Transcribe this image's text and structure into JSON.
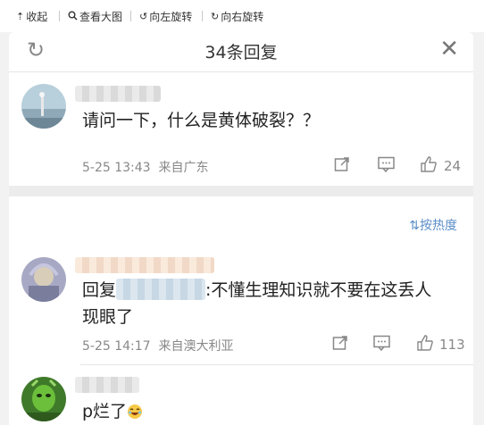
{
  "toolbar": {
    "collapse_icon": "upload-arrow-icon",
    "collapse": "收起",
    "view_large_icon": "magnifier-icon",
    "view_large": "查看大图",
    "rotate_left_icon": "rotate-left-icon",
    "rotate_left": "向左旋转",
    "rotate_right_icon": "rotate-right-icon",
    "rotate_right": "向右旋转"
  },
  "header": {
    "refresh_icon": "refresh-icon",
    "title": "34条回复",
    "close_icon": "close-icon"
  },
  "original": {
    "text": "请问一下，什么是黄体破裂？？",
    "time": "5-25 13:43",
    "location": "来自广东",
    "likes": "24"
  },
  "sort": {
    "icon": "sort-icon",
    "label": "按热度"
  },
  "replies": [
    {
      "prefix": "回复",
      "body": ":不懂生理知识就不要在这丢人现眼了",
      "time": "5-25 14:17",
      "location": "来自澳大利亚",
      "likes": "113"
    },
    {
      "body": "p烂了",
      "emoji": "laughing-emoji-icon"
    }
  ],
  "colors": {
    "background": "#f2f2f2",
    "panel": "#ffffff",
    "sort_link": "#5b8ec7",
    "meta_text": "#888888"
  }
}
